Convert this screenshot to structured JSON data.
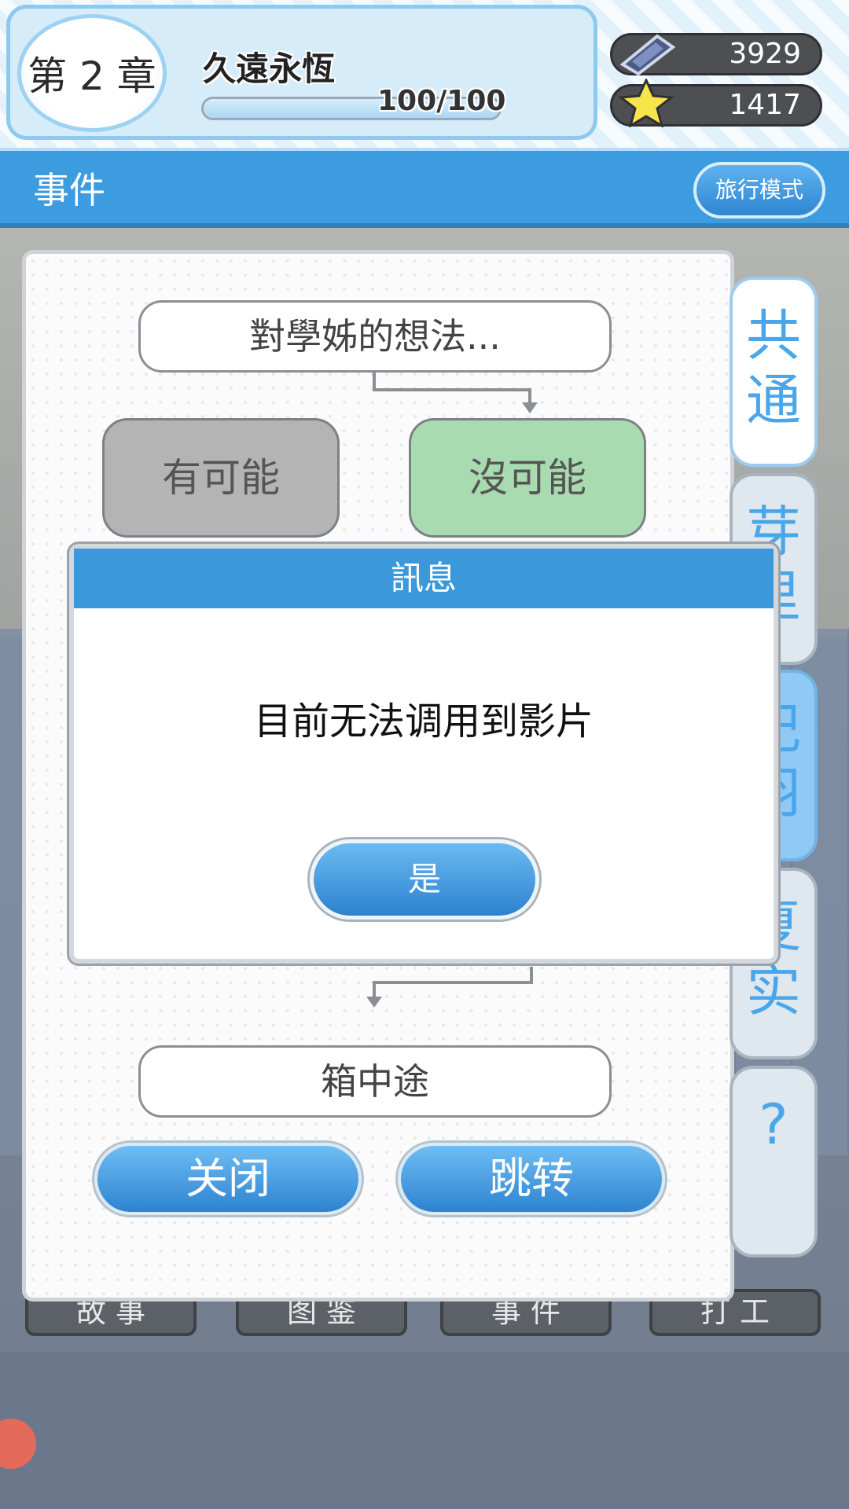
{
  "header": {
    "chapter_label": "第 2 章",
    "chapter_name": "久遠永恆",
    "progress_text": "100/100",
    "progress_fraction": 1.0,
    "gem_count": "3929",
    "star_count": "1417"
  },
  "titlebar": {
    "title": "事件",
    "travel_mode": "旅行模式"
  },
  "event_flow": {
    "question": "對學姊的想法...",
    "choice_left": "有可能",
    "choice_right": "沒可能",
    "next_node": "箱中途"
  },
  "side_tabs": [
    {
      "label": "共\n通"
    },
    {
      "label": "芽\n里"
    },
    {
      "label": "妃\n羽"
    },
    {
      "label": "夏\n实"
    },
    {
      "label": "?"
    }
  ],
  "buttons": {
    "close": "关闭",
    "jump": "跳转"
  },
  "bottom_tabs": [
    "故 事",
    "图 鉴",
    "事 件",
    "打 工"
  ],
  "dialog": {
    "title": "訊息",
    "message": "目前无法调用到影片",
    "ok": "是"
  },
  "colors": {
    "accent_blue": "#3b99db",
    "choice_selected": "#a8dcb0",
    "choice_unselected": "#b4b4b4"
  }
}
